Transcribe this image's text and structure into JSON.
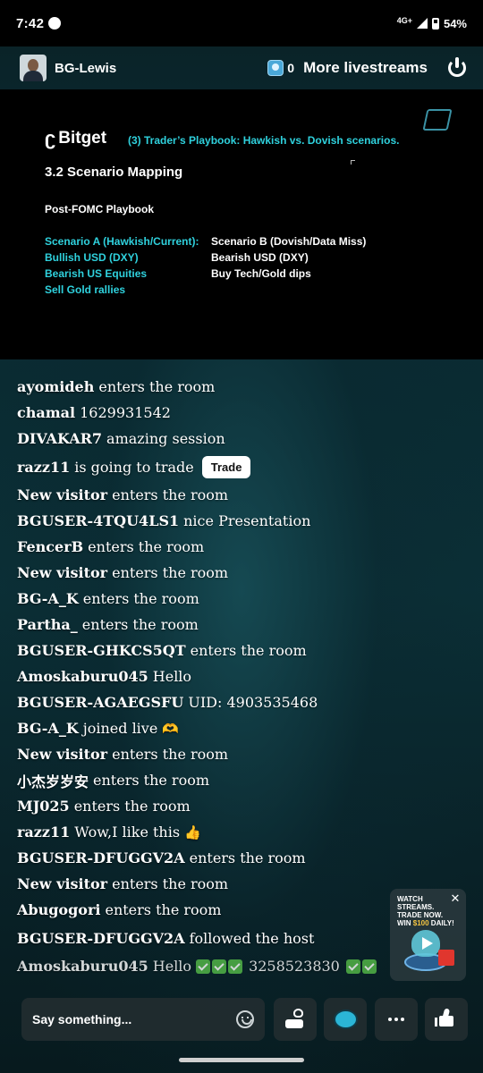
{
  "status_bar": {
    "time": "7:42",
    "network": "4G+",
    "battery": "54%"
  },
  "header": {
    "host_name": "BG-Lewis",
    "viewer_count": "0",
    "more_livestreams": "More livestreams"
  },
  "slide": {
    "logo": "Bitget",
    "title": "(3) Trader’s Playbook: Hawkish vs. Dovish scenarios.",
    "heading": "3.2 Scenario Mapping",
    "subheading": "Post-FOMC Playbook",
    "scenario_a": [
      "Scenario A (Hawkish/Current):",
      "Bullish USD (DXY)",
      "Bearish US Equities",
      "Sell Gold rallies"
    ],
    "scenario_b": [
      "Scenario B (Dovish/Data Miss)",
      "Bearish USD (DXY)",
      "Buy Tech/Gold dips"
    ]
  },
  "chat": [
    {
      "user": "ayomideh",
      "text": "enters the room"
    },
    {
      "user": "chamal",
      "text": "1629931542"
    },
    {
      "user": "DIVAKAR7",
      "text": "amazing session"
    },
    {
      "user": "razz11",
      "text": "is going to trade",
      "button": "Trade"
    },
    {
      "user": "New visitor",
      "text": "enters the room"
    },
    {
      "user": "BGUSER-4TQU4LS1",
      "text": "nice Presentation"
    },
    {
      "user": "FencerB",
      "text": "enters the room"
    },
    {
      "user": "New visitor",
      "text": "enters the room"
    },
    {
      "user": "BG-A_K",
      "text": "enters the room"
    },
    {
      "user": "Partha_",
      "text": "enters the room"
    },
    {
      "user": "BGUSER-GHKCS5QT",
      "text": "enters the room"
    },
    {
      "user": "Amoskaburu045",
      "text": "Hello"
    },
    {
      "user": "BGUSER-AGAEGSFU",
      "text": "UID: 4903535468"
    },
    {
      "user": "BG-A_K",
      "text": "joined live",
      "emoji": "🫶"
    },
    {
      "user": "New visitor",
      "text": "enters the room"
    },
    {
      "user": "小杰岁岁安",
      "text": "enters the room"
    },
    {
      "user": "MJ025",
      "text": "enters the room"
    },
    {
      "user": "razz11",
      "text": "Wow,I like this",
      "emoji": "👍"
    },
    {
      "user": "BGUSER-DFUGGV2A",
      "text": "enters the room"
    },
    {
      "user": "New visitor",
      "text": "enters the room"
    },
    {
      "user": "Abugogori",
      "text": "enters the room"
    },
    {
      "user": "BGUSER-DFUGGV2A",
      "text": "followed the host"
    },
    {
      "user": "Amoskaburu045",
      "text": "Hello",
      "text2": "3258523830"
    }
  ],
  "promo": {
    "line1": "WATCH",
    "line2": "STREAMS.",
    "line3": "TRADE NOW.",
    "line4_prefix": "WIN ",
    "line4_highlight": "$100",
    "line4_suffix": " DAILY!"
  },
  "bottom_bar": {
    "placeholder": "Say something..."
  },
  "colors": {
    "accent": "#2fd1dd",
    "background": "#0b2f36",
    "trade_button": "#ffffff"
  },
  "icons": [
    "power-icon",
    "viewer-icon",
    "smile-icon",
    "gift-hand-icon",
    "coin-icon",
    "more-dots-icon",
    "thumbs-up-icon",
    "close-icon"
  ]
}
